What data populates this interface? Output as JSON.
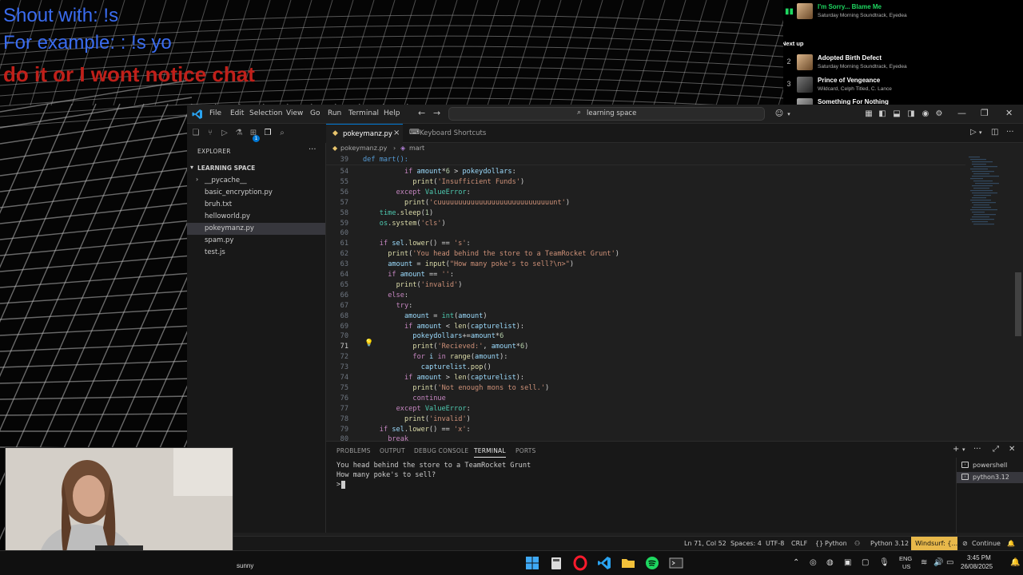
{
  "overlay": {
    "line1": "Shout with: !s",
    "line2": "For example: : !s yo",
    "line3": "do it or I wont notice chat"
  },
  "spotify": {
    "now_playing": {
      "title": "I'm Sorry... Blame Me",
      "artist": "Saturday Morning Soundtrack, Eyedea"
    },
    "next_up_label": "Next up",
    "queue": [
      {
        "num": "2",
        "title": "Adopted Birth Defect",
        "artist": "Saturday Morning Soundtrack, Eyedea"
      },
      {
        "num": "3",
        "title": "Prince of Vengeance",
        "artist": "Wildcard, Celph Titled, C. Lance"
      },
      {
        "num": "",
        "title": "Something For Nothing",
        "artist": ""
      }
    ]
  },
  "vscode": {
    "menu": [
      "File",
      "Edit",
      "Selection",
      "View",
      "Go",
      "Run",
      "Terminal",
      "Help"
    ],
    "search_text": "learning space",
    "explorer_title": "EXPLORER",
    "folder_name": "LEARNING SPACE",
    "files": [
      {
        "name": "__pycache__",
        "folder": true
      },
      {
        "name": "basic_encryption.py"
      },
      {
        "name": "bruh.txt"
      },
      {
        "name": "helloworld.py"
      },
      {
        "name": "pokeymanz.py",
        "selected": true
      },
      {
        "name": "spam.py"
      },
      {
        "name": "test.js"
      }
    ],
    "activity_badge": "1",
    "tabs": [
      {
        "label": "pokeymanz.py",
        "active": true
      },
      {
        "label": "Keyboard Shortcuts",
        "active": false
      }
    ],
    "breadcrumb": {
      "file": "pokeymanz.py",
      "symbol": "mart"
    },
    "sticky": {
      "num": "39",
      "text": "def mart():"
    },
    "code_lines": [
      {
        "num": "54",
        "indent": 10,
        "tokens": [
          [
            "kw",
            "if "
          ],
          [
            "vr",
            "amount"
          ],
          [
            "op",
            "*"
          ],
          [
            "nm",
            "6"
          ],
          [
            "op",
            " > "
          ],
          [
            "vr",
            "pokeydollars"
          ],
          [
            "op",
            ":"
          ]
        ]
      },
      {
        "num": "55",
        "indent": 12,
        "tokens": [
          [
            "fn",
            "print"
          ],
          [
            "op",
            "("
          ],
          [
            "st",
            "'Insufficient Funds'"
          ],
          [
            "op",
            ")"
          ]
        ]
      },
      {
        "num": "56",
        "indent": 8,
        "tokens": [
          [
            "kw",
            "except "
          ],
          [
            "cl",
            "ValueError"
          ],
          [
            "op",
            ":"
          ]
        ]
      },
      {
        "num": "57",
        "indent": 10,
        "tokens": [
          [
            "fn",
            "print"
          ],
          [
            "op",
            "("
          ],
          [
            "st",
            "'cuuuuuuuuuuuuuuuuuuuuuuuuuuuunt'"
          ],
          [
            "op",
            ")"
          ]
        ]
      },
      {
        "num": "58",
        "indent": 4,
        "tokens": [
          [
            "cl",
            "time"
          ],
          [
            "op",
            "."
          ],
          [
            "fn",
            "sleep"
          ],
          [
            "op",
            "("
          ],
          [
            "nm",
            "1"
          ],
          [
            "op",
            ")"
          ]
        ]
      },
      {
        "num": "59",
        "indent": 4,
        "tokens": [
          [
            "cl",
            "os"
          ],
          [
            "op",
            "."
          ],
          [
            "fn",
            "system"
          ],
          [
            "op",
            "("
          ],
          [
            "st",
            "'cls'"
          ],
          [
            "op",
            ")"
          ]
        ]
      },
      {
        "num": "60",
        "indent": 0,
        "tokens": []
      },
      {
        "num": "61",
        "indent": 4,
        "tokens": [
          [
            "kw",
            "if "
          ],
          [
            "vr",
            "sel"
          ],
          [
            "op",
            "."
          ],
          [
            "fn",
            "lower"
          ],
          [
            "op",
            "() == "
          ],
          [
            "st",
            "'s'"
          ],
          [
            "op",
            ":"
          ]
        ]
      },
      {
        "num": "62",
        "indent": 6,
        "tokens": [
          [
            "fn",
            "print"
          ],
          [
            "op",
            "("
          ],
          [
            "st",
            "'You head behind the store to a TeamRocket Grunt'"
          ],
          [
            "op",
            ")"
          ]
        ]
      },
      {
        "num": "63",
        "indent": 6,
        "tokens": [
          [
            "vr",
            "amount"
          ],
          [
            "op",
            " = "
          ],
          [
            "fn",
            "input"
          ],
          [
            "op",
            "("
          ],
          [
            "st",
            "\"How many poke's to sell?\\n>\""
          ],
          [
            "op",
            ")"
          ]
        ]
      },
      {
        "num": "64",
        "indent": 6,
        "tokens": [
          [
            "kw",
            "if "
          ],
          [
            "vr",
            "amount"
          ],
          [
            "op",
            " == "
          ],
          [
            "st",
            "''"
          ],
          [
            "op",
            ":"
          ]
        ]
      },
      {
        "num": "65",
        "indent": 8,
        "tokens": [
          [
            "fn",
            "print"
          ],
          [
            "op",
            "("
          ],
          [
            "st",
            "'invalid'"
          ],
          [
            "op",
            ")"
          ]
        ]
      },
      {
        "num": "66",
        "indent": 6,
        "tokens": [
          [
            "kw",
            "else"
          ],
          [
            "op",
            ":"
          ]
        ]
      },
      {
        "num": "67",
        "indent": 8,
        "tokens": [
          [
            "kw",
            "try"
          ],
          [
            "op",
            ":"
          ]
        ]
      },
      {
        "num": "68",
        "indent": 10,
        "tokens": [
          [
            "vr",
            "amount"
          ],
          [
            "op",
            " = "
          ],
          [
            "cl",
            "int"
          ],
          [
            "op",
            "("
          ],
          [
            "vr",
            "amount"
          ],
          [
            "op",
            ")"
          ]
        ]
      },
      {
        "num": "69",
        "indent": 10,
        "tokens": [
          [
            "kw",
            "if "
          ],
          [
            "vr",
            "amount"
          ],
          [
            "op",
            " < "
          ],
          [
            "fn",
            "len"
          ],
          [
            "op",
            "("
          ],
          [
            "vr",
            "capturelist"
          ],
          [
            "op",
            "):"
          ]
        ]
      },
      {
        "num": "70",
        "indent": 12,
        "tokens": [
          [
            "vr",
            "pokeydollars"
          ],
          [
            "op",
            "+="
          ],
          [
            "vr",
            "amount"
          ],
          [
            "op",
            "*"
          ],
          [
            "nm",
            "6"
          ]
        ]
      },
      {
        "num": "71",
        "indent": 12,
        "tokens": [
          [
            "fn",
            "print"
          ],
          [
            "op",
            "("
          ],
          [
            "st",
            "'Recieved:'"
          ],
          [
            "op",
            ", "
          ],
          [
            "vr",
            "amount"
          ],
          [
            "op",
            "*"
          ],
          [
            "nm",
            "6"
          ],
          [
            "op",
            ")"
          ]
        ],
        "current": true
      },
      {
        "num": "72",
        "indent": 12,
        "tokens": [
          [
            "kw",
            "for "
          ],
          [
            "vr",
            "i"
          ],
          [
            "kw",
            " in "
          ],
          [
            "fn",
            "range"
          ],
          [
            "op",
            "("
          ],
          [
            "vr",
            "amount"
          ],
          [
            "op",
            "):"
          ]
        ]
      },
      {
        "num": "73",
        "indent": 14,
        "tokens": [
          [
            "vr",
            "capturelist"
          ],
          [
            "op",
            "."
          ],
          [
            "fn",
            "pop"
          ],
          [
            "op",
            "()"
          ]
        ]
      },
      {
        "num": "74",
        "indent": 10,
        "tokens": [
          [
            "kw",
            "if "
          ],
          [
            "vr",
            "amount"
          ],
          [
            "op",
            " > "
          ],
          [
            "fn",
            "len"
          ],
          [
            "op",
            "("
          ],
          [
            "vr",
            "capturelist"
          ],
          [
            "op",
            "):"
          ]
        ]
      },
      {
        "num": "75",
        "indent": 12,
        "tokens": [
          [
            "fn",
            "print"
          ],
          [
            "op",
            "("
          ],
          [
            "st",
            "'Not enough mons to sell.'"
          ],
          [
            "op",
            ")"
          ]
        ]
      },
      {
        "num": "76",
        "indent": 12,
        "tokens": [
          [
            "kw",
            "continue"
          ]
        ]
      },
      {
        "num": "77",
        "indent": 8,
        "tokens": [
          [
            "kw",
            "except "
          ],
          [
            "cl",
            "ValueError"
          ],
          [
            "op",
            ":"
          ]
        ]
      },
      {
        "num": "78",
        "indent": 10,
        "tokens": [
          [
            "fn",
            "print"
          ],
          [
            "op",
            "("
          ],
          [
            "st",
            "'invalid'"
          ],
          [
            "op",
            ")"
          ]
        ]
      },
      {
        "num": "79",
        "indent": 4,
        "tokens": [
          [
            "kw",
            "if "
          ],
          [
            "vr",
            "sel"
          ],
          [
            "op",
            "."
          ],
          [
            "fn",
            "lower"
          ],
          [
            "op",
            "() == "
          ],
          [
            "st",
            "'x'"
          ],
          [
            "op",
            ":"
          ]
        ]
      },
      {
        "num": "80",
        "indent": 6,
        "tokens": [
          [
            "kw",
            "break"
          ]
        ]
      }
    ],
    "panel_tabs": [
      "PROBLEMS",
      "OUTPUT",
      "DEBUG CONSOLE",
      "TERMINAL",
      "PORTS"
    ],
    "active_panel_tab": "TERMINAL",
    "terminal_lines": [
      "You head behind the store to a TeamRocket Grunt",
      "How many poke's to sell?",
      ">"
    ],
    "terminals": [
      {
        "name": "powershell",
        "selected": false
      },
      {
        "name": "python3.12",
        "selected": true
      }
    ],
    "status": {
      "position": "Ln 71, Col 52",
      "spaces": "Spaces: 4",
      "encoding": "UTF-8",
      "eol": "CRLF",
      "language": "Python",
      "interpreter": "Python 3.12",
      "windsurf": "Windsurf: {...}",
      "continue": "Continue"
    }
  },
  "taskbar": {
    "weather": "sunny",
    "lang_top": "ENG",
    "lang_bottom": "US",
    "time": "3:45 PM",
    "date": "26/08/2025"
  },
  "colors": {
    "accent": "#0078d4",
    "windsurf": "#e8b84a",
    "spotify_green": "#1ed760"
  }
}
